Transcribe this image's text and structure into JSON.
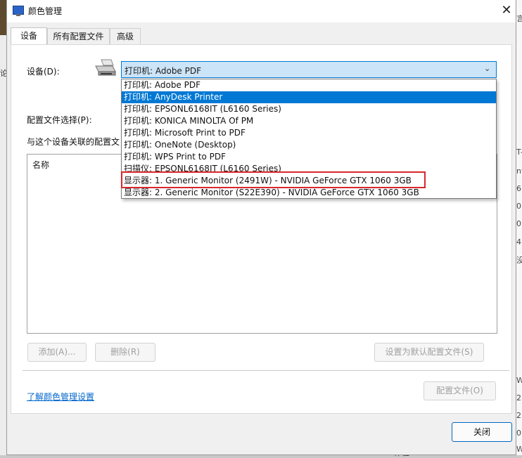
{
  "dialog": {
    "title": "颜色管理",
    "close_glyph": "✕",
    "tabs": [
      {
        "label": "设备",
        "active": true
      },
      {
        "label": "所有配置文件",
        "active": false
      },
      {
        "label": "高级",
        "active": false
      }
    ]
  },
  "device": {
    "label": "设备(D):",
    "selected": "打印机: Adobe PDF",
    "options": [
      "打印机: Adobe PDF",
      "打印机: AnyDesk Printer",
      "打印机: EPSONL6168IT (L6160 Series)",
      "打印机: KONICA MINOLTA Of PM",
      "打印机: Microsoft Print to PDF",
      "打印机: OneNote (Desktop)",
      "打印机: WPS Print to PDF",
      "扫描仪: EPSONL6168IT (L6160 Series)",
      "显示器: 1. Generic Monitor (2491W) - NVIDIA GeForce GTX 1060 3GB",
      "显示器: 2. Generic Monitor (S22E390) - NVIDIA GeForce GTX 1060 3GB"
    ],
    "hovered_option_index": 1,
    "annotated_option_index": 8
  },
  "profile_select_label": "配置文件选择(P):",
  "associated_label": "与这个设备关联的配置文",
  "profiles_list": {
    "column_header": "名称"
  },
  "buttons": {
    "add": "添加(A)...",
    "remove": "删除(R)",
    "set_default": "设置为默认配置文件(S)",
    "profiles": "配置文件(O)",
    "close": "关闭"
  },
  "learn_link": "了解颜色管理设置",
  "background_fragments": {
    "left": [
      "论"
    ],
    "right": [
      "言",
      "T-",
      "nt",
      "6.",
      "0",
      "0",
      "4",
      "没",
      "Wi",
      "2",
      "2",
      "0",
      "Wi"
    ],
    "bottom": "体验"
  },
  "colors": {
    "accent": "#0078d4",
    "annotation": "#d9272b",
    "link": "#0066cc"
  }
}
